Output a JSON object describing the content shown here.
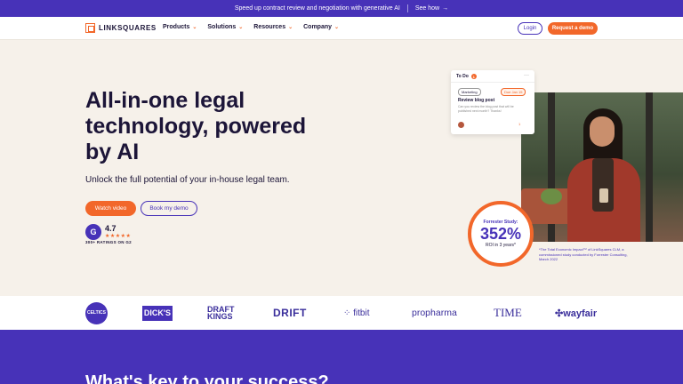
{
  "banner": {
    "text": "Speed up contract review and negotiation with generative AI",
    "link": "See how",
    "arrow": "→"
  },
  "nav": {
    "logo": "LINKSQUARES",
    "menu": [
      {
        "label": "Products",
        "chev": "⌄"
      },
      {
        "label": "Solutions",
        "chev": "⌄"
      },
      {
        "label": "Resources",
        "chev": "⌄"
      },
      {
        "label": "Company",
        "chev": "⌄"
      }
    ],
    "login": "Login",
    "demo": "Request a demo"
  },
  "hero": {
    "title": "All-in-one legal technology, powered by AI",
    "subtitle": "Unlock the full potential of your in-house legal team.",
    "watch": "Watch video",
    "book": "Book my demo",
    "g2": "G",
    "rating": "4.7",
    "stars": "★★★★★",
    "ratings_caption": "300+ RATINGS ON G2"
  },
  "todo": {
    "header": "To Do",
    "badge": "1",
    "more": "···",
    "tag": "Marketing",
    "due": "Due Jan 15",
    "title": "Review blog post",
    "body": "Can you review the blog post that will be published next month? Thanks!",
    "count": "1"
  },
  "roi": {
    "label": "Forrester Study:",
    "value": "352%",
    "sub": "ROI in 3 years*",
    "note": "*The Total Economic Impact™ of LinkSquares CLM, a commissioned study conducted by Forrester Consulting, March 2022"
  },
  "logos": {
    "celtics": "CELTICS",
    "dicks": "DICK'S",
    "draftkings_1": "DRAFT",
    "draftkings_2": "KINGS",
    "drift": "DRIFT",
    "fitbit": "⁘ fitbit",
    "propharma": "propharma",
    "time": "TIME",
    "wayfair": "✣wayfair"
  },
  "section": {
    "title": "What's key to your success?"
  },
  "colors": {
    "accent": "#f2672a",
    "brand": "#4732b8",
    "cream": "#f6f1ea"
  }
}
